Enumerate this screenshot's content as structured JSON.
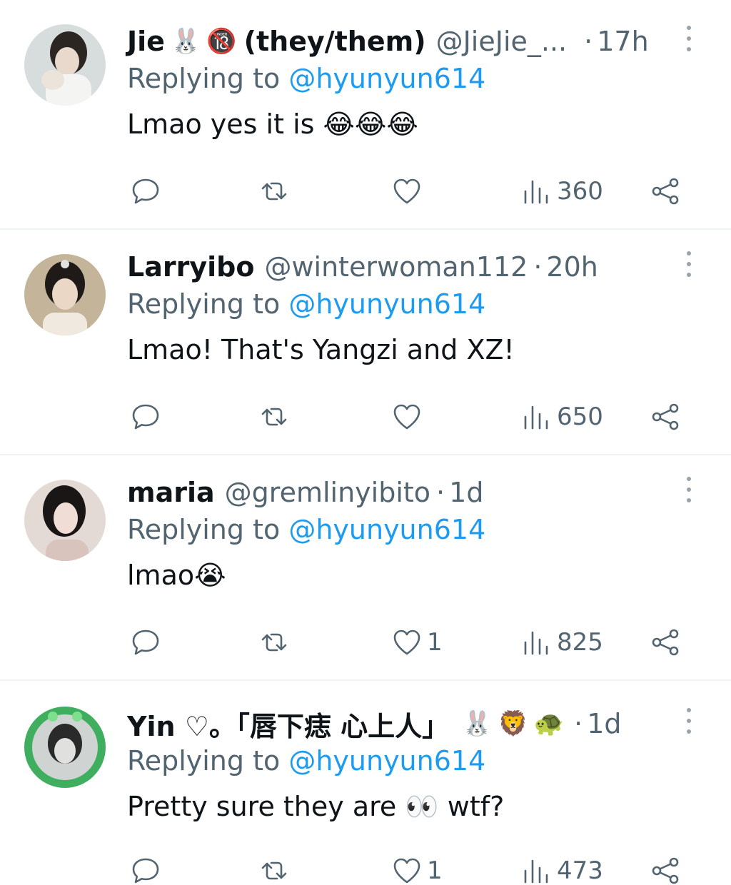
{
  "tweets": [
    {
      "display_name": "Jie",
      "name_extras": [
        "🐰",
        "🔞"
      ],
      "name_suffix": "(they/them)",
      "handle": "@JieJie_...",
      "time": "17h",
      "replying_prefix": "Replying to",
      "replying_to": "@hyunyun614",
      "text": "Lmao yes it is 😂😂😂",
      "likes": "",
      "views": "360",
      "avatar_color": "#cfd6d8"
    },
    {
      "display_name": "Larryibo",
      "name_extras": [],
      "name_suffix": "",
      "handle": "@winterwoman112",
      "time": "20h",
      "replying_prefix": "Replying to",
      "replying_to": "@hyunyun614",
      "text": "Lmao! That's Yangzi and XZ!",
      "likes": "",
      "views": "650",
      "avatar_color": "#b9a88f"
    },
    {
      "display_name": "maria",
      "name_extras": [],
      "name_suffix": "",
      "handle": "@gremlinyibito",
      "time": "1d",
      "replying_prefix": "Replying to",
      "replying_to": "@hyunyun614",
      "text": "lmao😭",
      "likes": "1",
      "views": "825",
      "avatar_color": "#d9cfcc"
    },
    {
      "display_name": "Yin ♡。「唇下痣 心上人」",
      "name_extras": [
        "🐰",
        "🦁",
        "🐢"
      ],
      "name_suffix": "",
      "handle": "",
      "time": "1d",
      "replying_prefix": "Replying to",
      "replying_to": "@hyunyun614",
      "text": "Pretty sure they are 👀 wtf?",
      "likes": "1",
      "views": "473",
      "avatar_color": "#4bb86a"
    }
  ],
  "icons": {
    "reply": "reply-icon",
    "repost": "repost-icon",
    "like": "heart-icon",
    "views": "views-icon",
    "share": "share-icon",
    "more": "more-dots-icon"
  },
  "colors": {
    "link": "#1d9bf0",
    "muted": "#536471",
    "text": "#0f1419",
    "divider": "#eff3f4"
  }
}
